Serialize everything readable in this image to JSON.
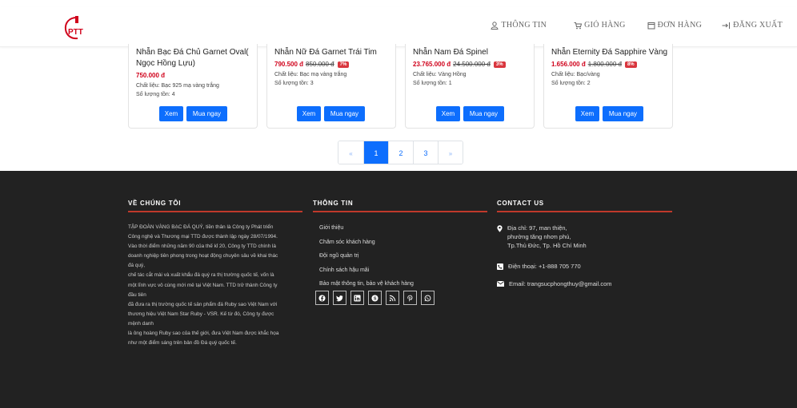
{
  "header": {
    "logo_text": "PTT",
    "nav": [
      {
        "label": "THÔNG TIN",
        "icon": "user-icon"
      },
      {
        "label": "GIỎ HÀNG",
        "icon": "cart-icon"
      },
      {
        "label": "ĐƠN HÀNG",
        "icon": "calendar-icon"
      },
      {
        "label": "ĐĂNG XUẤT",
        "icon": "logout-icon"
      }
    ]
  },
  "products": [
    {
      "name": "Nhẫn Bạc Đá Chủ Garnet Oval( Ngọc Hồng Lựu)",
      "price": "750.000 đ",
      "old_price": "",
      "discount": "",
      "material": "Chất liệu: Bạc 925 mạ vàng trắng",
      "stock": "Số lượng tồn: 4",
      "view_label": "Xem",
      "buy_label": "Mua ngay"
    },
    {
      "name": "Nhẫn Nữ Đá Garnet Trái Tim",
      "price": "790.500 đ",
      "old_price": "850.000 đ",
      "discount": "7%",
      "material": "Chất liệu: Bạc mạ vàng trắng",
      "stock": "Số lượng tồn: 3",
      "view_label": "Xem",
      "buy_label": "Mua ngay"
    },
    {
      "name": "Nhẫn Nam Đá Spinel",
      "price": "23.765.000 đ",
      "old_price": "24.500.000 đ",
      "discount": "3%",
      "material": "Chất liệu: Vàng Hồng",
      "stock": "Số lượng tồn: 1",
      "view_label": "Xem",
      "buy_label": "Mua ngay"
    },
    {
      "name": "Nhẫn Eternity Đá Sapphire Vàng",
      "price": "1.656.000 đ",
      "old_price": "1.800.000 đ",
      "discount": "8%",
      "material": "Chất liệu: Bạc/vàng",
      "stock": "Số lượng tồn: 2",
      "view_label": "Xem",
      "buy_label": "Mua ngay"
    }
  ],
  "pagination": {
    "prev": "«",
    "pages": [
      "1",
      "2",
      "3"
    ],
    "next": "»",
    "active": "1"
  },
  "footer": {
    "about_title": "VỀ CHÚNG TÔI",
    "about_lines": [
      "TẬP ĐOÀN VÀNG BẠC ĐÁ QUÝ, tiền thân là Công ty Phát triển",
      "Công nghệ và Thương mại TTD được thành lập ngày 28/07/1994.",
      "Vào thời điểm những năm 90 của thế kỉ 20, Công ty TTD chính là",
      "doanh nghiệp tiên phong trong hoạt động chuyên sâu về khai thác",
      "đá quý,",
      "chế tác cắt mài và xuất khẩu đá quý ra thị trường quốc tế, vốn là",
      "một lĩnh vực vô cùng mới mẻ tại Việt Nam. TTD trở thành Công ty",
      "đầu tiên",
      "đã đưa ra thị trường quốc tế sản phẩm đá Ruby sao Việt Nam với",
      "thương hiệu Việt Nam Star Ruby - VSR. Kế từ đó, Công ty được",
      "mệnh danh",
      "là ông hoàng Ruby sao của thế giới, đưa Việt Nam được khắc họa",
      "như một điểm sáng trên bản đồ Đá quý quốc tế."
    ],
    "info_title": "THÔNG TIN",
    "links": [
      "Giới thiệu",
      "Chăm sóc khách hàng",
      "Đội ngũ quản trị",
      "Chính sách hậu mãi",
      "Bảo mật thông tin, bảo vệ khách hàng"
    ],
    "socials": [
      "facebook-icon",
      "twitter-icon",
      "linkedin-icon",
      "skype-icon",
      "rss-icon",
      "pinterest-icon",
      "whatsapp-icon"
    ],
    "contact_title": "CONTACT US",
    "address_lines": [
      "Địa chỉ: 97, man thiện,",
      "phường tăng nhơn phú,",
      "Tp.Thủ Đức, Tp. Hồ Chí Minh"
    ],
    "phone": "Điện thoại: +1-888 705 770",
    "email": "Email: trangsucphongthuy@gmail.com"
  },
  "colors": {
    "primary": "#0d6efd",
    "accent_red": "#c0392b",
    "footer_bg": "#222222",
    "price_red": "#d0021b"
  }
}
